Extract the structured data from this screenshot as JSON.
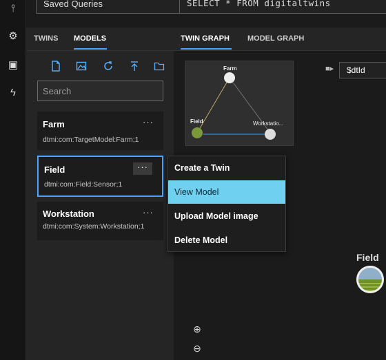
{
  "topbar": {
    "saved_queries": "Saved Queries",
    "query": "SELECT * FROM digitaltwins"
  },
  "left_panel": {
    "tabs": [
      "TWINS",
      "MODELS"
    ],
    "active_tab": "MODELS",
    "search_placeholder": "Search",
    "models": [
      {
        "name": "Farm",
        "id": "dtmi:com:TargetModel:Farm;1"
      },
      {
        "name": "Field",
        "id": "dtmi:com:Field:Sensor;1"
      },
      {
        "name": "Workstation",
        "id": "dtmi:com:System:Workstation;1"
      }
    ],
    "more_label": "···"
  },
  "graph": {
    "tabs": [
      "TWIN GRAPH",
      "MODEL GRAPH"
    ],
    "active_tab": "TWIN GRAPH",
    "label_property": "$dtId",
    "minimap_nodes": [
      "Farm",
      "Field",
      "Workstatio..."
    ],
    "field_node_label": "Field"
  },
  "context_menu": {
    "items": [
      "Create a Twin",
      "View Model",
      "Upload Model image",
      "Delete Model"
    ],
    "highlighted": "View Model"
  },
  "colors": {
    "accent": "#4da3ff",
    "highlight": "#6fd0f0"
  }
}
